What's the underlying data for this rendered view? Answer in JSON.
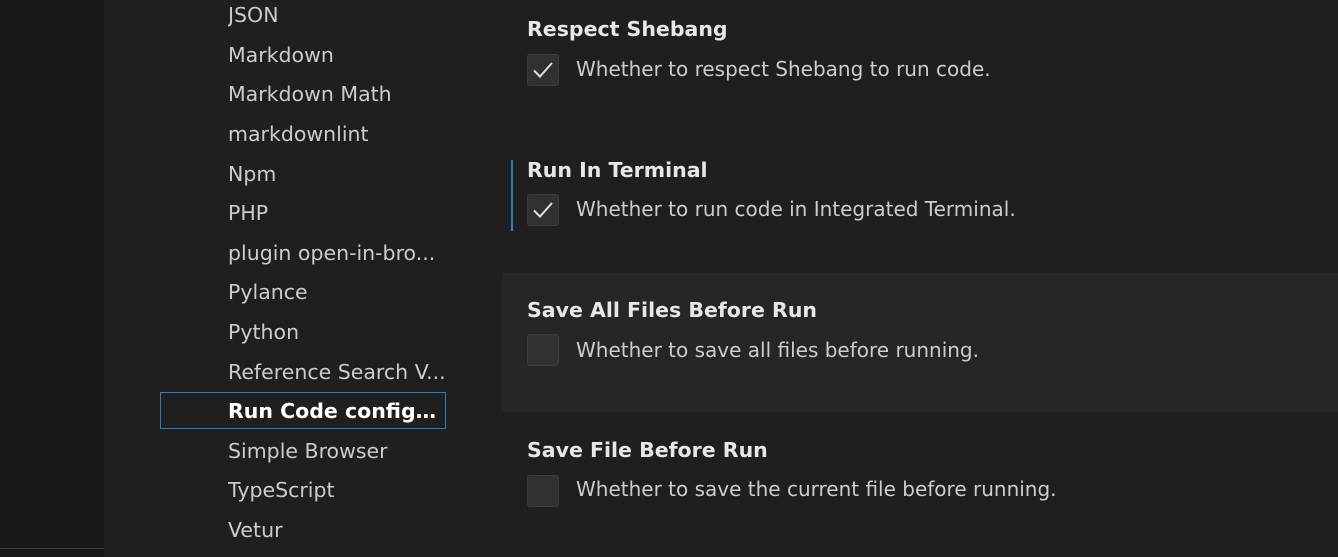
{
  "toc": {
    "items": [
      {
        "label": "JSON"
      },
      {
        "label": "Markdown"
      },
      {
        "label": "Markdown Math"
      },
      {
        "label": "markdownlint"
      },
      {
        "label": "Npm"
      },
      {
        "label": "PHP"
      },
      {
        "label": "plugin open-in-bro..."
      },
      {
        "label": "Pylance"
      },
      {
        "label": "Python"
      },
      {
        "label": "Reference Search V..."
      },
      {
        "label": "Run Code configu..."
      },
      {
        "label": "Simple Browser"
      },
      {
        "label": "TypeScript"
      },
      {
        "label": "Vetur"
      }
    ],
    "selected_label": "Run Code configu..."
  },
  "settings": [
    {
      "title": "Respect Shebang",
      "description": "Whether to respect Shebang to run code.",
      "checked": true
    },
    {
      "title": "Run In Terminal",
      "description": "Whether to run code in Integrated Terminal.",
      "checked": true
    },
    {
      "title": "Save All Files Before Run",
      "description": "Whether to save all files before running.",
      "checked": false
    },
    {
      "title": "Save File Before Run",
      "description": "Whether to save the current file before running.",
      "checked": false
    }
  ],
  "colors": {
    "background": "#1f1f1f",
    "focus_accent": "#2a7fc2",
    "check": "#e0e0e0"
  },
  "icons": {
    "check": "check-icon"
  }
}
